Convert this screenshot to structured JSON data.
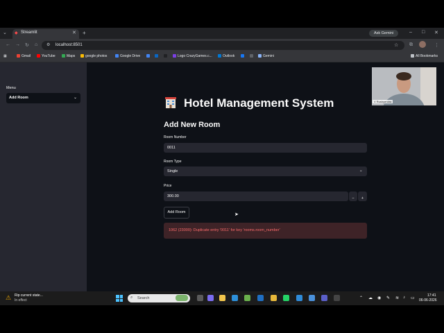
{
  "browser": {
    "tab_title": "Streamlit",
    "new_tab_symbol": "+",
    "ask_gemini": "Ask Gemini",
    "url": "localhost:8501",
    "bookmarks": [
      {
        "label": "Gmail",
        "color": "#ea4335"
      },
      {
        "label": "YouTube",
        "color": "#ff0000"
      },
      {
        "label": "Maps",
        "color": "#34a853"
      },
      {
        "label": "google photos",
        "color": "#fbbc04"
      },
      {
        "label": "Google Drive",
        "color": "#4285f4"
      },
      {
        "label": "",
        "color": "#4285f4"
      },
      {
        "label": "",
        "color": "#0a66c2"
      },
      {
        "label": "",
        "color": "#202124"
      },
      {
        "label": "Logo CrazyGames.c...",
        "color": "#7b3fe4"
      },
      {
        "label": "Outlook",
        "color": "#0078d4"
      },
      {
        "label": "",
        "color": "#1877f2"
      },
      {
        "label": "",
        "color": "#5f6368"
      },
      {
        "label": "Gemini",
        "color": "#8ab4f8"
      }
    ],
    "all_bookmarks": "All Bookmarks"
  },
  "sidebar": {
    "menu_label": "Menu",
    "menu_selected": "Add Room"
  },
  "main": {
    "title": "Hotel Management System",
    "subtitle": "Add New Room",
    "room_number_label": "Room Number",
    "room_number_value": "0011",
    "room_type_label": "Room Type",
    "room_type_value": "Single",
    "price_label": "Price",
    "price_value": "300.00",
    "minus_symbol": "−",
    "plus_symbol": "+",
    "button_label": "Add Room",
    "error_message": "1062 (23000): Duplicate entry '0011' for key 'rooms.room_number'"
  },
  "webcam": {
    "name_label": "V Rushyendra"
  },
  "taskbar": {
    "notification_title": "Rip current state...",
    "notification_subtitle": "In effect",
    "search_placeholder": "Search",
    "time": "17:41",
    "date": "06-06-2026"
  },
  "colors": {
    "accent_red": "#ff4b4b",
    "app_background": "#0e1117",
    "sidebar_background": "#262730",
    "error_background": "#3e2327",
    "error_text": "#ff6c6c"
  }
}
